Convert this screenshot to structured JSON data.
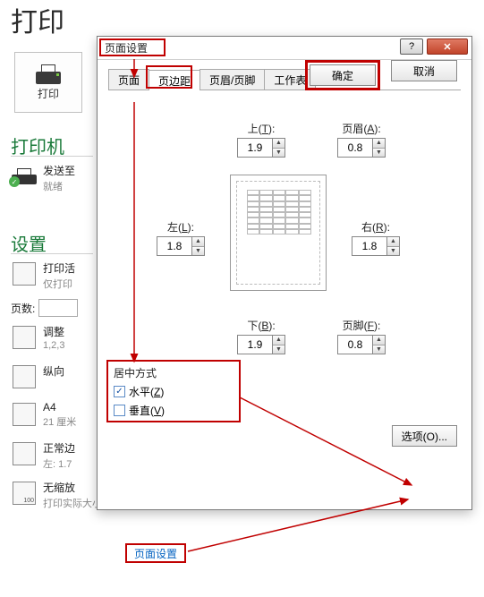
{
  "page_title": "打印",
  "print_button_label": "打印",
  "printer_section": "打印机",
  "printer_row": {
    "main": "发送至",
    "sub": "就绪"
  },
  "settings_section": "设置",
  "rows": {
    "print_active": {
      "main": "打印活",
      "sub": "仅打印"
    },
    "pages_label": "页数:",
    "collate": {
      "main": "调整",
      "sub": "1,2,3"
    },
    "portrait": {
      "main": "纵向"
    },
    "a4": {
      "main": "A4",
      "sub": "21 厘米"
    },
    "margins": {
      "main": "正常边",
      "sub": "左: 1.7"
    },
    "scale": {
      "main": "无缩放",
      "sub": "打印实际大小的工作表"
    }
  },
  "link_text": "页面设置",
  "dialog": {
    "title": "页面设置",
    "tabs": [
      "页面",
      "页边距",
      "页眉/页脚",
      "工作表"
    ],
    "fields": {
      "top": {
        "label_pre": "上(",
        "key": "T",
        "label_post": "):",
        "value": "1.9"
      },
      "header": {
        "label_pre": "页眉(",
        "key": "A",
        "label_post": "):",
        "value": "0.8"
      },
      "left": {
        "label_pre": "左(",
        "key": "L",
        "label_post": "):",
        "value": "1.8"
      },
      "right": {
        "label_pre": "右(",
        "key": "R",
        "label_post": "):",
        "value": "1.8"
      },
      "bottom": {
        "label_pre": "下(",
        "key": "B",
        "label_post": "):",
        "value": "1.9"
      },
      "footer": {
        "label_pre": "页脚(",
        "key": "F",
        "label_post": "):",
        "value": "0.8"
      }
    },
    "center_title": "居中方式",
    "center_h": {
      "label_pre": "水平(",
      "key": "Z",
      "label_post": ")",
      "checked": true
    },
    "center_v": {
      "label_pre": "垂直(",
      "key": "V",
      "label_post": ")",
      "checked": false
    },
    "options_btn": "选项(O)...",
    "ok": "确定",
    "cancel": "取消"
  }
}
